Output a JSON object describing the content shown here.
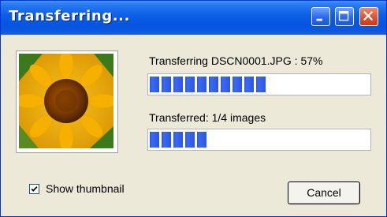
{
  "window": {
    "title": "Transferring..."
  },
  "transfer": {
    "current_file_label": "Transferring DSCN0001.JPG : 57%",
    "current_file_progress_percent": 57,
    "overall_label": "Transferred: 1/4 images",
    "overall_done": 1,
    "overall_total": 4
  },
  "options": {
    "show_thumbnail_label": "Show thumbnail",
    "show_thumbnail_checked": true
  },
  "buttons": {
    "cancel_label": "Cancel"
  },
  "icons": {
    "minimize": "minimize-icon",
    "maximize": "maximize-icon",
    "close": "close-icon",
    "checkmark": "checkmark-icon"
  },
  "colors": {
    "titlebar": "#0a5ee8",
    "progress_fill": "#2a55e8",
    "dialog_bg": "#ece9d8",
    "close_button": "#e0502e"
  }
}
